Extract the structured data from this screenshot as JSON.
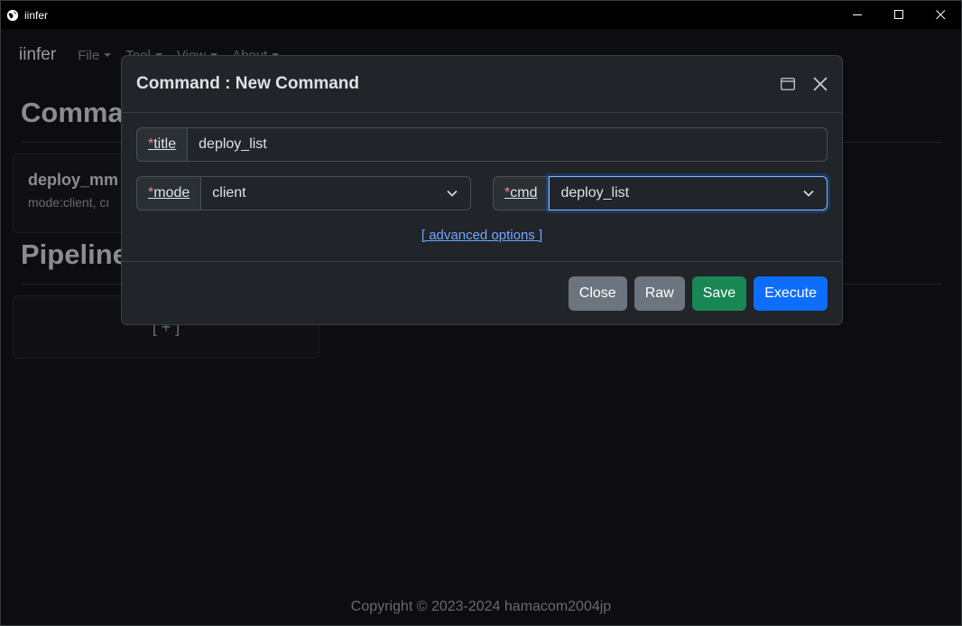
{
  "window": {
    "title": "iinfer"
  },
  "navbar": {
    "brand": "iinfer",
    "menus": [
      {
        "label": "File"
      },
      {
        "label": "Tool"
      },
      {
        "label": "View"
      },
      {
        "label": "About"
      }
    ]
  },
  "sections": {
    "commands_title": "Comman",
    "pipelines_title": "Pipeline"
  },
  "command_card": {
    "title": "deploy_mm",
    "subtitle": "mode:client, cı"
  },
  "pipeline_card": {
    "add_label": "[ + ]"
  },
  "footer": {
    "copyright": "Copyright © 2023-2024 hamacom2004jp"
  },
  "modal": {
    "title": "Command : New Command",
    "fields": {
      "title": {
        "req": "*",
        "label": "title",
        "value": "deploy_list"
      },
      "mode": {
        "req": "*",
        "label": "mode",
        "value": "client"
      },
      "cmd": {
        "req": "*",
        "label": "cmd",
        "value": "deploy_list"
      }
    },
    "advanced_link": "[ advanced options ]",
    "buttons": {
      "close": "Close",
      "raw": "Raw",
      "save": "Save",
      "execute": "Execute"
    }
  }
}
